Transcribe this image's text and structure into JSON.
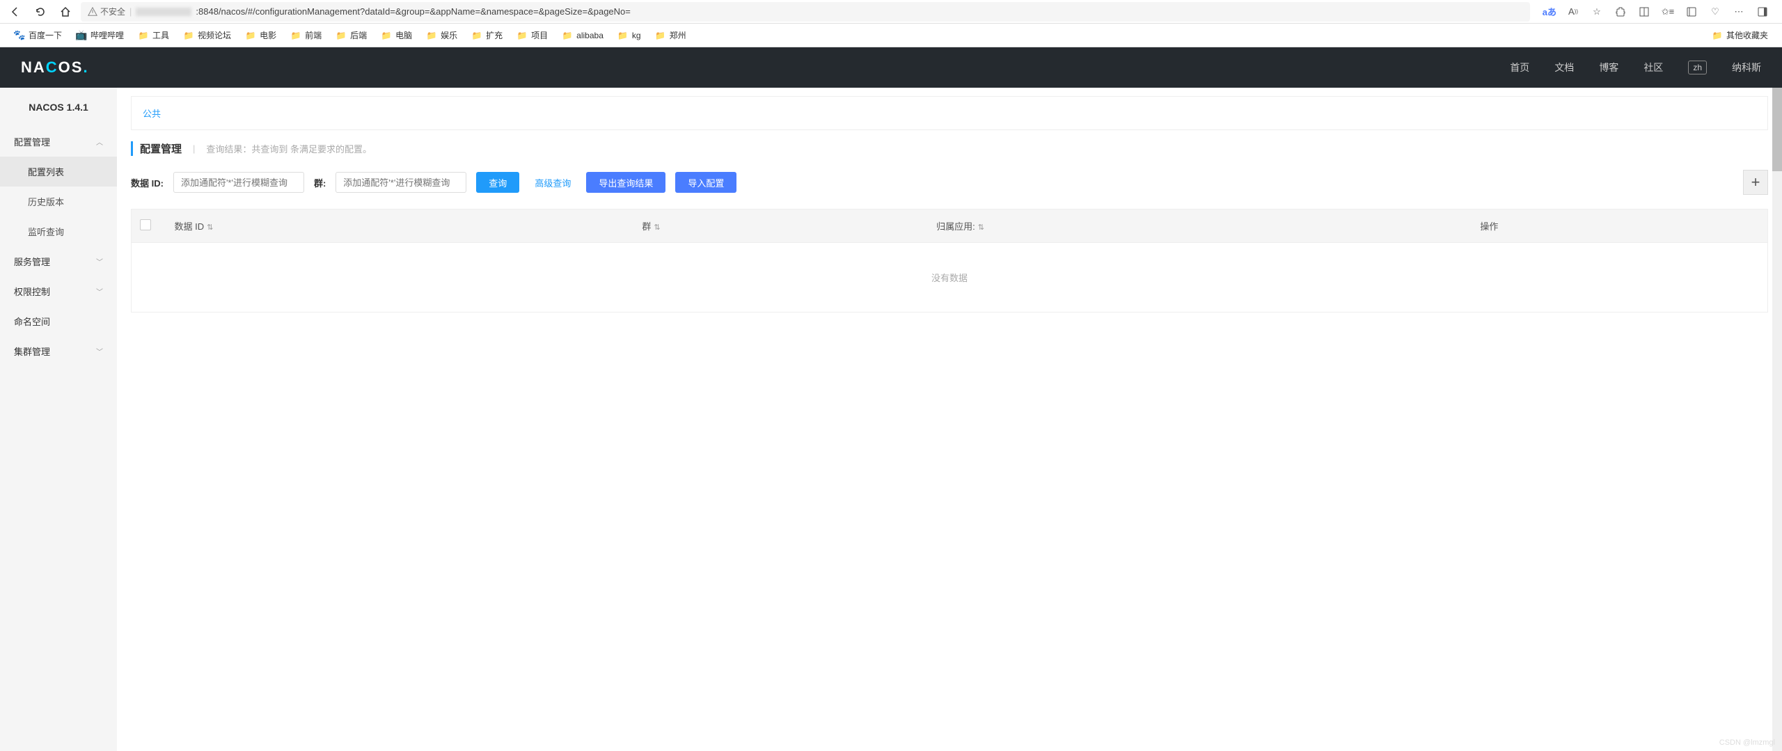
{
  "browser": {
    "insecure_label": "不安全",
    "url_suffix": ":8848/nacos/#/configurationManagement?dataId=&group=&appName=&namespace=&pageSize=&pageNo=",
    "translate": "aあ"
  },
  "bookmarks": {
    "items": [
      "百度一下",
      "哔哩哔哩",
      "工具",
      "视频论坛",
      "电影",
      "前端",
      "后端",
      "电脑",
      "娱乐",
      "扩充",
      "项目",
      "alibaba",
      "kg",
      "郑州"
    ],
    "other": "其他收藏夹"
  },
  "header": {
    "nav": [
      "首页",
      "文档",
      "博客",
      "社区"
    ],
    "lang": "zh",
    "user": "纳科斯"
  },
  "sidebar": {
    "title": "NACOS 1.4.1",
    "groups": {
      "config": {
        "label": "配置管理",
        "items": [
          "配置列表",
          "历史版本",
          "监听查询"
        ]
      },
      "service": {
        "label": "服务管理"
      },
      "permission": {
        "label": "权限控制"
      },
      "namespace": {
        "label": "命名空间"
      },
      "cluster": {
        "label": "集群管理"
      }
    }
  },
  "main": {
    "namespace_tab": "公共",
    "page_title": "配置管理",
    "query_result": "查询结果：共查询到 条满足要求的配置。",
    "search": {
      "dataId_label": "数据 ID:",
      "dataId_placeholder": "添加通配符'*'进行模糊查询",
      "group_label": "群:",
      "group_placeholder": "添加通配符'*'进行模糊查询",
      "query_btn": "查询",
      "advanced_btn": "高级查询",
      "export_btn": "导出查询结果",
      "import_btn": "导入配置"
    },
    "table": {
      "headers": [
        "数据 ID",
        "群",
        "归属应用:",
        "操作"
      ],
      "empty": "没有数据"
    }
  },
  "watermark": "CSDN @lmzmgl"
}
